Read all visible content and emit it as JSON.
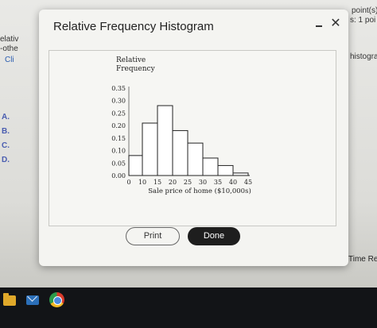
{
  "background": {
    "left_partial": [
      "elativ",
      "-othe",
      "Cli"
    ],
    "options": [
      "A.",
      "B.",
      "C.",
      "D."
    ],
    "right_partial": [
      "point(s)",
      "s: 1 poi",
      "histogram"
    ],
    "time_remaining": "Time Re"
  },
  "modal": {
    "title": "Relative Frequency Histogram",
    "minimize_label": "–",
    "close_label": "✕",
    "print_label": "Print",
    "done_label": "Done"
  },
  "chart_data": {
    "type": "bar",
    "ylabel": "Relative\nFrequency",
    "xlabel": "Sale price of home ($10,000s)",
    "x_ticks": [
      0,
      10,
      15,
      20,
      25,
      30,
      35,
      40,
      45
    ],
    "y_ticks": [
      "0.00",
      "0.05",
      "0.10",
      "0.15",
      "0.20",
      "0.25",
      "0.30",
      "0.35"
    ],
    "ylim": [
      0,
      0.35
    ],
    "bins": [
      {
        "start": 5,
        "end": 10,
        "value": 0.08
      },
      {
        "start": 10,
        "end": 15,
        "value": 0.21
      },
      {
        "start": 15,
        "end": 20,
        "value": 0.28
      },
      {
        "start": 20,
        "end": 25,
        "value": 0.18
      },
      {
        "start": 25,
        "end": 30,
        "value": 0.13
      },
      {
        "start": 30,
        "end": 35,
        "value": 0.07
      },
      {
        "start": 35,
        "end": 40,
        "value": 0.04
      },
      {
        "start": 40,
        "end": 45,
        "value": 0.01
      }
    ]
  }
}
